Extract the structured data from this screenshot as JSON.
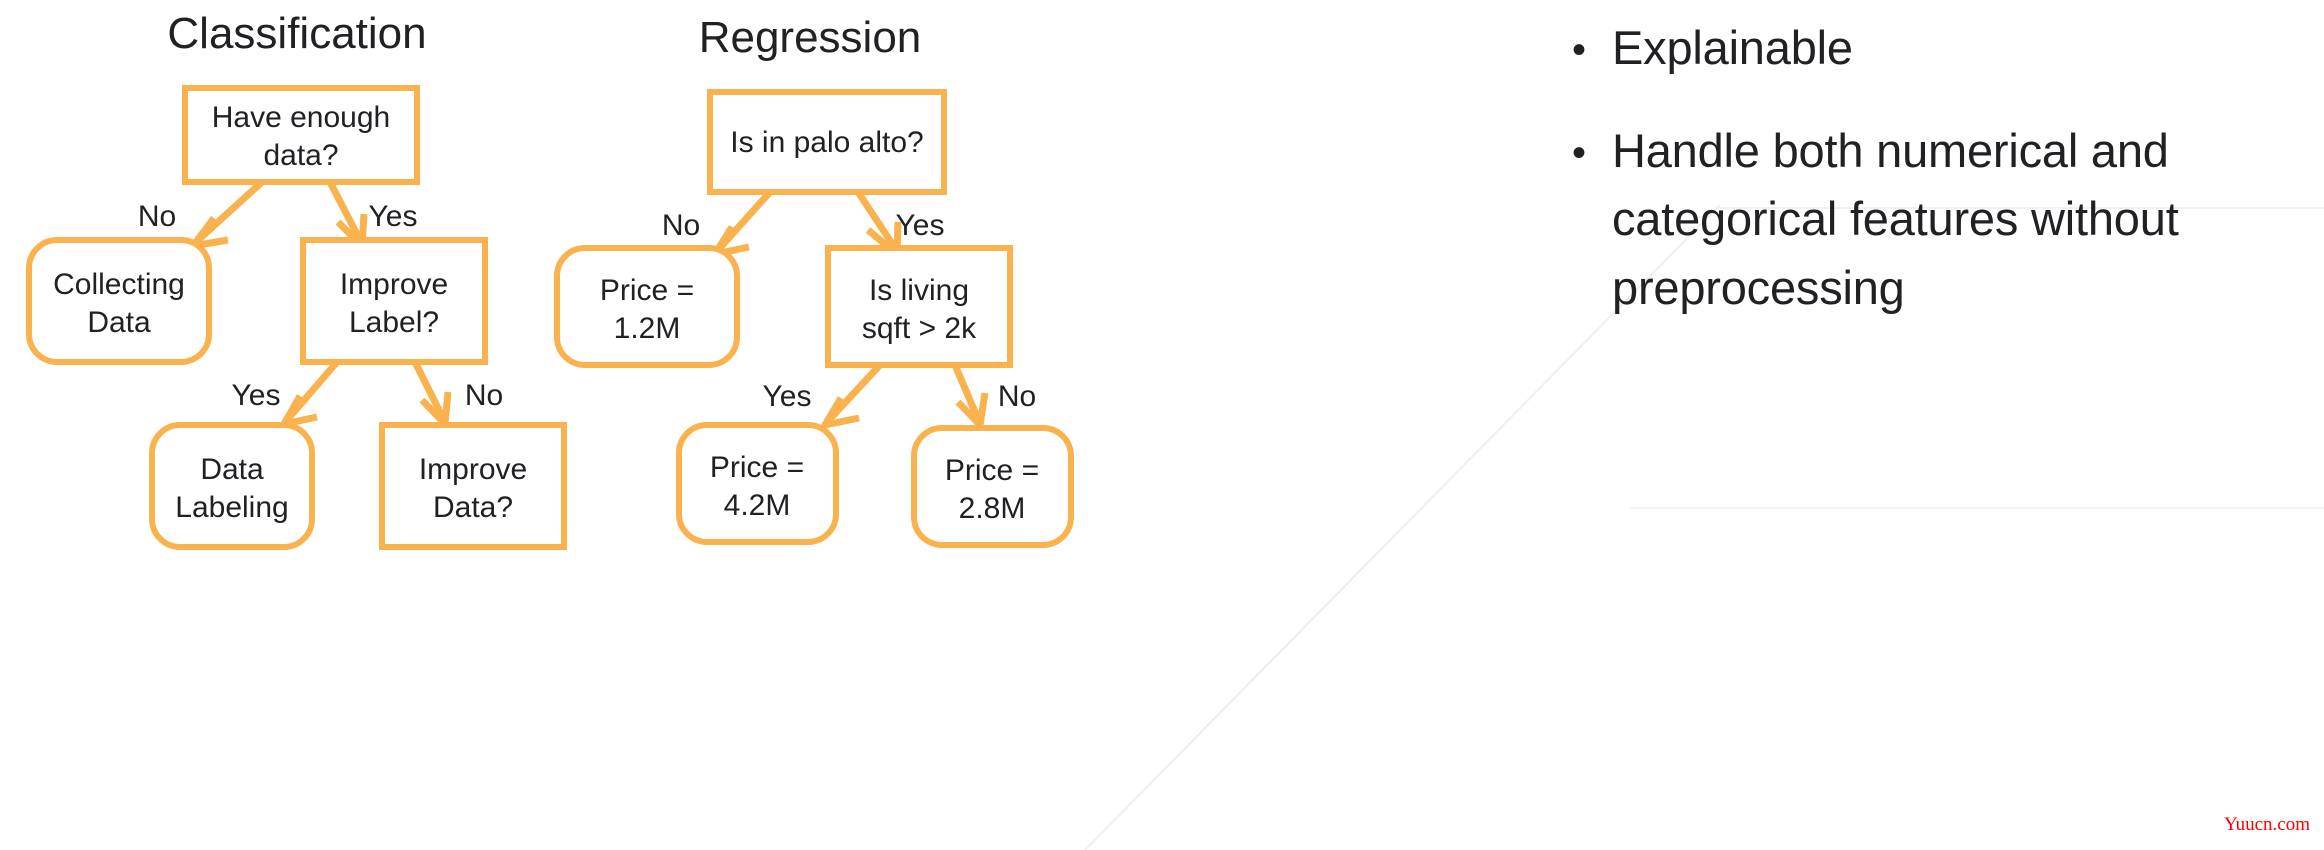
{
  "slide": {
    "background_color": "#ffffff",
    "accent_color": "#F9B24E",
    "text_color": "#202124",
    "watermark": "Yuucn.com",
    "watermark_color": "#ff0000"
  },
  "diagrams": [
    {
      "id": "classification",
      "title": "Classification",
      "nodes": [
        {
          "id": "c-root",
          "label_lines": [
            "Have enough",
            "data?"
          ],
          "shape": "rect"
        },
        {
          "id": "c-left",
          "label_lines": [
            "Collecting",
            "Data"
          ],
          "shape": "rounded"
        },
        {
          "id": "c-right",
          "label_lines": [
            "Improve",
            "Label?"
          ],
          "shape": "rect"
        },
        {
          "id": "c-ll",
          "label_lines": [
            "Data",
            "Labeling"
          ],
          "shape": "rounded"
        },
        {
          "id": "c-lr",
          "label_lines": [
            "Improve",
            "Data?"
          ],
          "shape": "rect"
        }
      ],
      "edges": [
        {
          "from": "c-root",
          "to": "c-left",
          "label": "No"
        },
        {
          "from": "c-root",
          "to": "c-right",
          "label": "Yes"
        },
        {
          "from": "c-right",
          "to": "c-ll",
          "label": "Yes"
        },
        {
          "from": "c-right",
          "to": "c-lr",
          "label": "No"
        }
      ]
    },
    {
      "id": "regression",
      "title": "Regression",
      "nodes": [
        {
          "id": "r-root",
          "label_lines": [
            "Is in palo alto?"
          ],
          "shape": "rect"
        },
        {
          "id": "r-left",
          "label_lines": [
            "Price =",
            "1.2M"
          ],
          "shape": "rounded"
        },
        {
          "id": "r-right",
          "label_lines": [
            "Is living",
            "sqft > 2k"
          ],
          "shape": "rect"
        },
        {
          "id": "r-rl",
          "label_lines": [
            "Price =",
            "4.2M"
          ],
          "shape": "rounded"
        },
        {
          "id": "r-rr",
          "label_lines": [
            "Price =",
            "2.8M"
          ],
          "shape": "rounded"
        }
      ],
      "edges": [
        {
          "from": "r-root",
          "to": "r-left",
          "label": "No"
        },
        {
          "from": "r-root",
          "to": "r-right",
          "label": "Yes"
        },
        {
          "from": "r-right",
          "to": "r-rl",
          "label": "Yes"
        },
        {
          "from": "r-right",
          "to": "r-rr",
          "label": "No"
        }
      ]
    }
  ],
  "bullets": [
    {
      "marker": "•",
      "text": "Explainable"
    },
    {
      "marker": "•",
      "text": "Handle both numerical and categorical features without preprocessing"
    }
  ]
}
